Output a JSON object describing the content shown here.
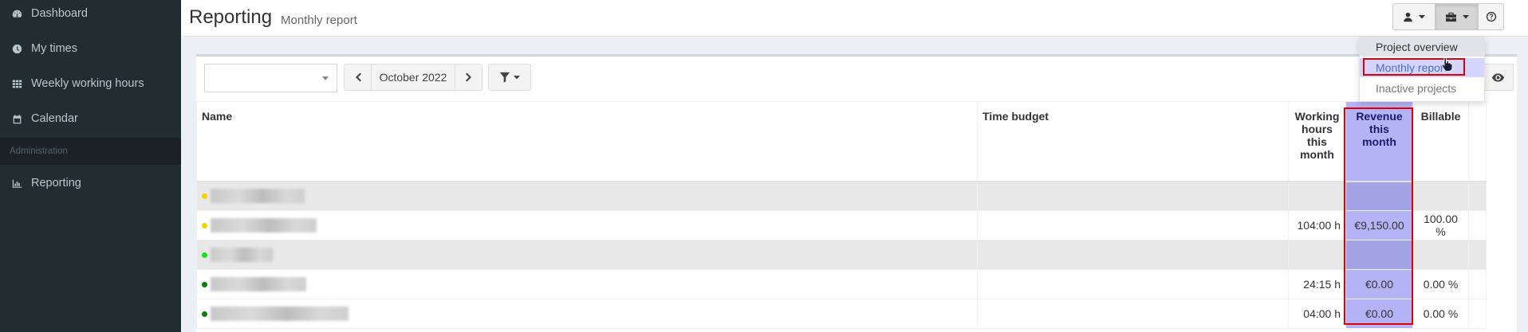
{
  "sidebar": {
    "items": [
      {
        "label": "Dashboard",
        "icon": "dashboard-icon"
      },
      {
        "label": "My times",
        "icon": "clock-icon"
      },
      {
        "label": "Weekly working hours",
        "icon": "grid-icon"
      },
      {
        "label": "Calendar",
        "icon": "calendar-icon"
      }
    ],
    "section_header": "Administration",
    "admin_items": [
      {
        "label": "Reporting",
        "icon": "bar-chart-icon"
      }
    ]
  },
  "header": {
    "title": "Reporting",
    "subtitle": "Monthly report"
  },
  "toolbar": {
    "select_value": "",
    "month": "October 2022"
  },
  "dropdown": {
    "items": [
      "Project overview",
      "Monthly report",
      "Inactive projects"
    ]
  },
  "table": {
    "headers": {
      "name": "Name",
      "time_budget": "Time budget",
      "working_hours": "Working hours this month",
      "revenue": "Revenue this month",
      "billable": "Billable"
    },
    "rows": [
      {
        "group": true,
        "dot_color": "#f5d100",
        "working_hours": "",
        "revenue": "",
        "billable": ""
      },
      {
        "group": false,
        "dot_color": "#f5d100",
        "working_hours": "104:00 h",
        "revenue": "€9,150.00",
        "billable": "100.00 %"
      },
      {
        "group": true,
        "dot_color": "#22dd22",
        "working_hours": "",
        "revenue": "",
        "billable": ""
      },
      {
        "group": false,
        "dot_color": "#0a7a0a",
        "working_hours": "24:15 h",
        "revenue": "€0.00",
        "billable": "0.00 %"
      },
      {
        "group": false,
        "dot_color": "#0a7a0a",
        "working_hours": "04:00 h",
        "revenue": "€0.00",
        "billable": "0.00 %"
      }
    ]
  },
  "colors": {
    "sidebar_bg": "#222d32",
    "highlight_column": "#b3b3f5",
    "annotation_red": "#e00000"
  }
}
